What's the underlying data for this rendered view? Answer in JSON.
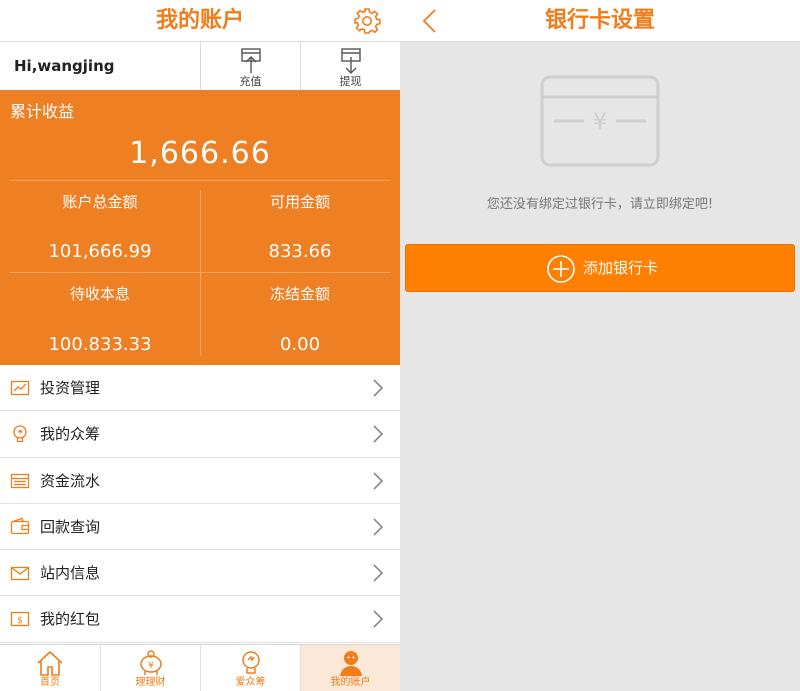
{
  "left": {
    "header": {
      "title": "我的账户",
      "settings_icon": "gear-icon"
    },
    "user": {
      "greeting": "Hi,wangjing"
    },
    "actions": [
      {
        "label": "充值",
        "icon": "deposit-icon"
      },
      {
        "label": "提现",
        "icon": "withdraw-icon"
      }
    ],
    "summary": {
      "label": "累计收益",
      "total": "1,666.66",
      "cells": [
        {
          "label": "账户总金额",
          "value": "101,666.99"
        },
        {
          "label": "可用金额",
          "value": "833.66"
        },
        {
          "label": "待收本息",
          "value": "100.833.33"
        },
        {
          "label": "冻结金额",
          "value": "0.00"
        }
      ]
    },
    "menu": [
      {
        "label": "投资管理",
        "icon": "chart-icon"
      },
      {
        "label": "我的众筹",
        "icon": "lightbulb-icon"
      },
      {
        "label": "资金流水",
        "icon": "ledger-icon"
      },
      {
        "label": "回款查询",
        "icon": "wallet-icon"
      },
      {
        "label": "站内信息",
        "icon": "mail-icon"
      },
      {
        "label": "我的红包",
        "icon": "red-envelope-icon"
      }
    ],
    "tabs": [
      {
        "label": "首页",
        "icon": "home-icon",
        "active": false
      },
      {
        "label": "理理财",
        "icon": "piggy-bank-icon",
        "active": false
      },
      {
        "label": "爱众筹",
        "icon": "lightbulb-icon",
        "active": false
      },
      {
        "label": "我的账户",
        "icon": "user-icon",
        "active": true
      }
    ]
  },
  "right": {
    "header": {
      "title": "银行卡设置",
      "back_icon": "back-arrow-icon"
    },
    "empty_icon": "bank-card-icon",
    "message": "您还没有绑定过银行卡，请立即绑定吧!",
    "add_button": {
      "label": "添加银行卡",
      "icon": "plus-circle-icon"
    }
  },
  "colors": {
    "accent": "#f07d1a",
    "panel": "#ee7f23",
    "button": "#ff7f00",
    "right_bg": "#e6e6e6"
  }
}
